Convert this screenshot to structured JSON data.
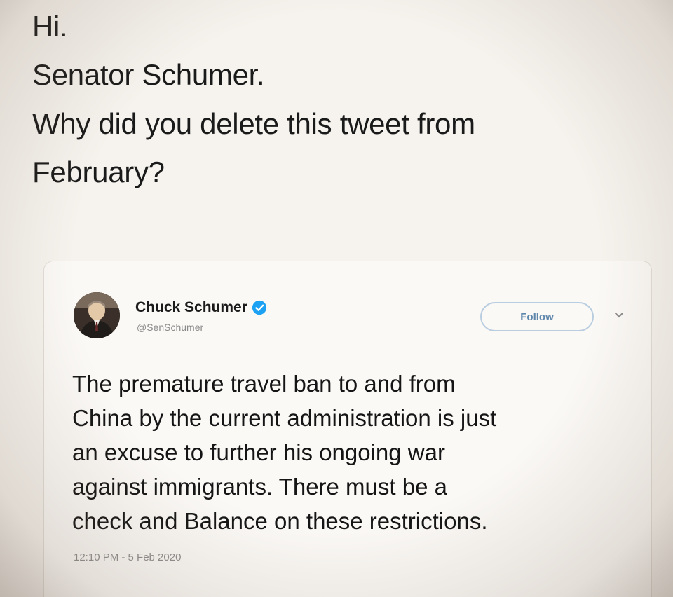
{
  "post": {
    "lines": [
      "Hi.",
      "Senator Schumer.",
      "Why did you delete this tweet from",
      "February?"
    ]
  },
  "tweet": {
    "author_name": "Chuck Schumer",
    "author_handle": "@SenSchumer",
    "follow_label": "Follow",
    "body_lines": [
      "The premature travel ban to and from",
      "China by the current administration is just",
      "an excuse to further his ongoing war",
      "against immigrants. There must be a",
      "check and Balance on these restrictions."
    ],
    "timestamp": "12:10 PM - 5 Feb 2020",
    "icons": {
      "verified": "verified-badge-icon",
      "caret": "chevron-down-icon"
    },
    "colors": {
      "verified": "#1da1f2",
      "follow_text": "#5f86ab",
      "follow_border": "#b9cde0"
    }
  }
}
